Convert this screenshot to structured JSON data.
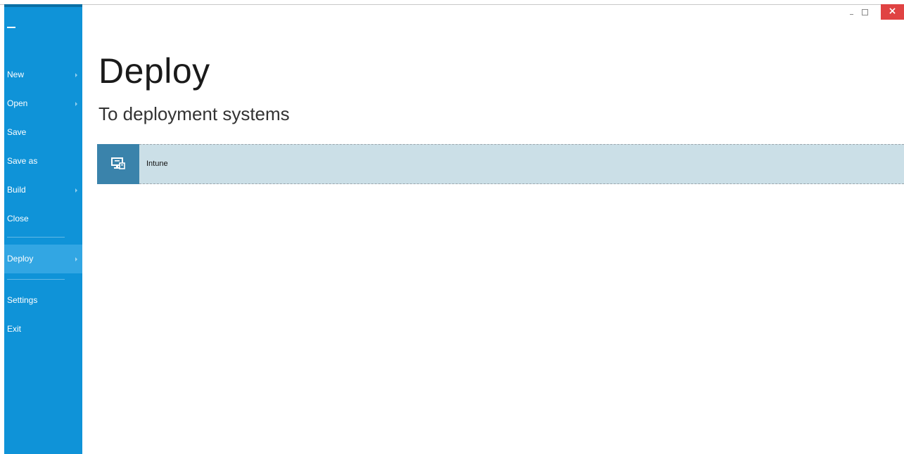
{
  "window": {
    "minimize_icon": "minimize-icon",
    "maximize_icon": "maximize-icon",
    "close_icon": "close-icon",
    "close_color": "#e04343"
  },
  "sidebar": {
    "background": "#0f93d8",
    "back_icon": "back-icon",
    "items": [
      {
        "label": "New",
        "has_submenu": true
      },
      {
        "label": "Open",
        "has_submenu": true
      },
      {
        "label": "Save",
        "has_submenu": false
      },
      {
        "label": "Save as",
        "has_submenu": false
      },
      {
        "label": "Build",
        "has_submenu": true
      },
      {
        "label": "Close",
        "has_submenu": false
      },
      {
        "label": "Deploy",
        "has_submenu": true,
        "active": true
      },
      {
        "label": "Settings",
        "has_submenu": false
      },
      {
        "label": "Exit",
        "has_submenu": false
      }
    ]
  },
  "main": {
    "title": "Deploy",
    "subtitle": "To deployment systems",
    "targets": [
      {
        "label": "Intune",
        "icon": "intune-deploy-icon"
      }
    ]
  },
  "colors": {
    "row_background": "#cbdfe7",
    "row_icon_background": "#3a83ab"
  }
}
